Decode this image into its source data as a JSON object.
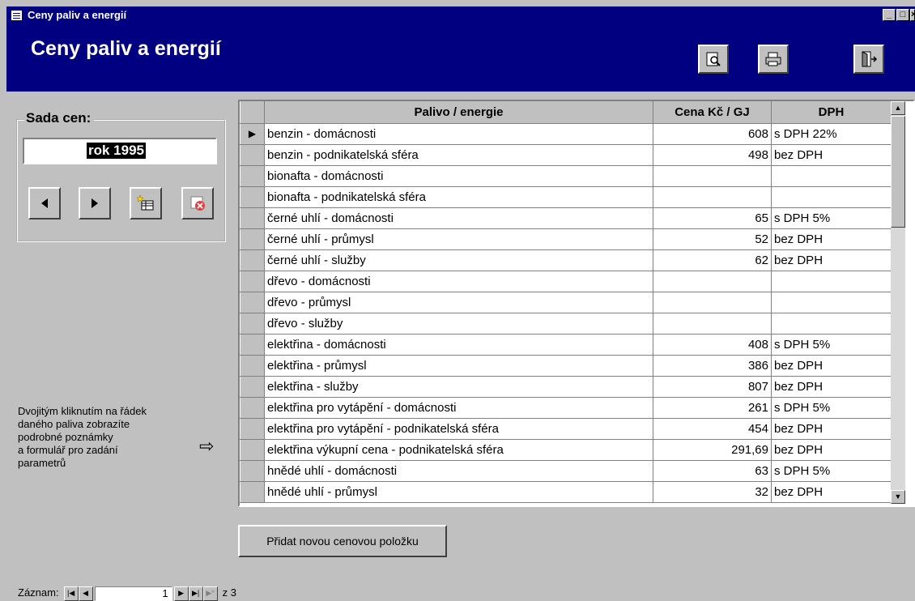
{
  "window": {
    "title": "Ceny paliv a energií",
    "controls": [
      "_",
      "□",
      "×"
    ]
  },
  "header": {
    "title": "Ceny paliv a energií",
    "buttons": [
      {
        "icon": "preview-icon"
      },
      {
        "icon": "printer-icon"
      },
      {
        "icon": "exit-door-icon"
      }
    ]
  },
  "price_set": {
    "label": "Sada cen:",
    "value": "rok 1995"
  },
  "hint": {
    "text_lines": [
      "Dvojitým kliknutím na řádek",
      "daného paliva zobrazíte",
      "podrobné poznámky",
      "a formulář pro zadání",
      "parametrů"
    ]
  },
  "grid": {
    "columns": [
      "Palivo / energie",
      "Cena Kč / GJ",
      "DPH"
    ],
    "rows": [
      {
        "name": "benzin - domácnosti",
        "price": "608",
        "vat": "s DPH 22%",
        "current": true
      },
      {
        "name": "benzin - podnikatelská sféra",
        "price": "498",
        "vat": "bez DPH"
      },
      {
        "name": "bionafta - domácnosti",
        "price": "",
        "vat": ""
      },
      {
        "name": "bionafta - podnikatelská sféra",
        "price": "",
        "vat": ""
      },
      {
        "name": "černé uhlí - domácnosti",
        "price": "65",
        "vat": "s DPH 5%"
      },
      {
        "name": "černé uhlí - průmysl",
        "price": "52",
        "vat": "bez DPH"
      },
      {
        "name": "černé uhlí - služby",
        "price": "62",
        "vat": "bez DPH"
      },
      {
        "name": "dřevo - domácnosti",
        "price": "",
        "vat": ""
      },
      {
        "name": "dřevo - průmysl",
        "price": "",
        "vat": ""
      },
      {
        "name": "dřevo - služby",
        "price": "",
        "vat": ""
      },
      {
        "name": "elektřina - domácnosti",
        "price": "408",
        "vat": "s DPH 5%"
      },
      {
        "name": "elektřina - průmysl",
        "price": "386",
        "vat": "bez DPH"
      },
      {
        "name": "elektřina - služby",
        "price": "807",
        "vat": "bez DPH"
      },
      {
        "name": "elektřina pro vytápění - domácnosti",
        "price": "261",
        "vat": "s DPH 5%"
      },
      {
        "name": "elektřina pro vytápění - podnikatelská sféra",
        "price": "454",
        "vat": "bez DPH"
      },
      {
        "name": "elektřina výkupní cena - podnikatelská sféra",
        "price": "291,69",
        "vat": "bez DPH"
      },
      {
        "name": "hnědé uhlí - domácnosti",
        "price": "63",
        "vat": "s DPH 5%"
      },
      {
        "name": "hnědé uhlí - průmysl",
        "price": "32",
        "vat": "bez DPH"
      }
    ]
  },
  "add_button": {
    "label": "Přidat novou cenovou položku"
  },
  "record_nav": {
    "label": "Záznam:",
    "current": "1",
    "of_text": "z 3"
  }
}
